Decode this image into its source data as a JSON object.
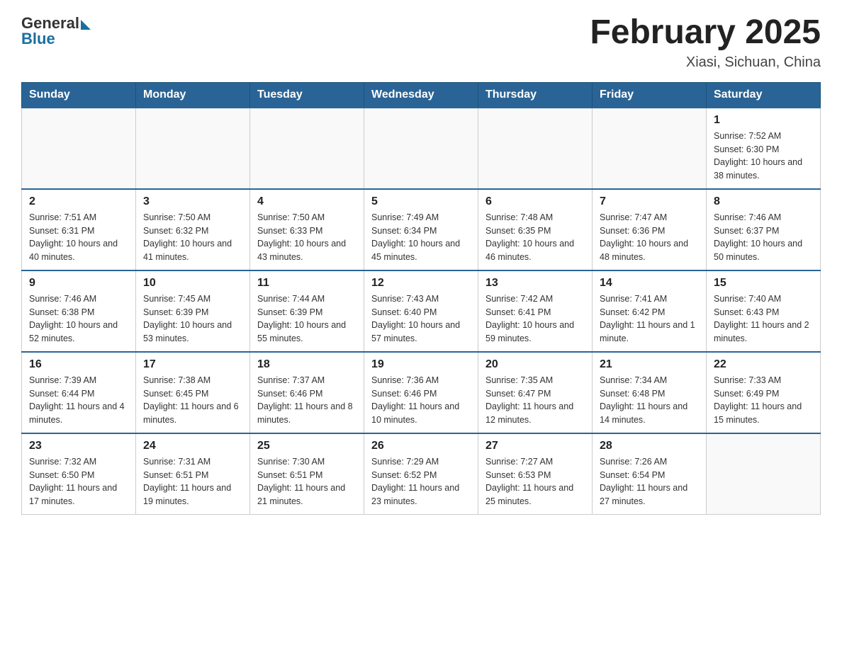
{
  "logo": {
    "general": "General",
    "blue": "Blue"
  },
  "title": {
    "month": "February 2025",
    "location": "Xiasi, Sichuan, China"
  },
  "weekdays": [
    "Sunday",
    "Monday",
    "Tuesday",
    "Wednesday",
    "Thursday",
    "Friday",
    "Saturday"
  ],
  "weeks": [
    [
      {
        "day": "",
        "info": ""
      },
      {
        "day": "",
        "info": ""
      },
      {
        "day": "",
        "info": ""
      },
      {
        "day": "",
        "info": ""
      },
      {
        "day": "",
        "info": ""
      },
      {
        "day": "",
        "info": ""
      },
      {
        "day": "1",
        "info": "Sunrise: 7:52 AM\nSunset: 6:30 PM\nDaylight: 10 hours and 38 minutes."
      }
    ],
    [
      {
        "day": "2",
        "info": "Sunrise: 7:51 AM\nSunset: 6:31 PM\nDaylight: 10 hours and 40 minutes."
      },
      {
        "day": "3",
        "info": "Sunrise: 7:50 AM\nSunset: 6:32 PM\nDaylight: 10 hours and 41 minutes."
      },
      {
        "day": "4",
        "info": "Sunrise: 7:50 AM\nSunset: 6:33 PM\nDaylight: 10 hours and 43 minutes."
      },
      {
        "day": "5",
        "info": "Sunrise: 7:49 AM\nSunset: 6:34 PM\nDaylight: 10 hours and 45 minutes."
      },
      {
        "day": "6",
        "info": "Sunrise: 7:48 AM\nSunset: 6:35 PM\nDaylight: 10 hours and 46 minutes."
      },
      {
        "day": "7",
        "info": "Sunrise: 7:47 AM\nSunset: 6:36 PM\nDaylight: 10 hours and 48 minutes."
      },
      {
        "day": "8",
        "info": "Sunrise: 7:46 AM\nSunset: 6:37 PM\nDaylight: 10 hours and 50 minutes."
      }
    ],
    [
      {
        "day": "9",
        "info": "Sunrise: 7:46 AM\nSunset: 6:38 PM\nDaylight: 10 hours and 52 minutes."
      },
      {
        "day": "10",
        "info": "Sunrise: 7:45 AM\nSunset: 6:39 PM\nDaylight: 10 hours and 53 minutes."
      },
      {
        "day": "11",
        "info": "Sunrise: 7:44 AM\nSunset: 6:39 PM\nDaylight: 10 hours and 55 minutes."
      },
      {
        "day": "12",
        "info": "Sunrise: 7:43 AM\nSunset: 6:40 PM\nDaylight: 10 hours and 57 minutes."
      },
      {
        "day": "13",
        "info": "Sunrise: 7:42 AM\nSunset: 6:41 PM\nDaylight: 10 hours and 59 minutes."
      },
      {
        "day": "14",
        "info": "Sunrise: 7:41 AM\nSunset: 6:42 PM\nDaylight: 11 hours and 1 minute."
      },
      {
        "day": "15",
        "info": "Sunrise: 7:40 AM\nSunset: 6:43 PM\nDaylight: 11 hours and 2 minutes."
      }
    ],
    [
      {
        "day": "16",
        "info": "Sunrise: 7:39 AM\nSunset: 6:44 PM\nDaylight: 11 hours and 4 minutes."
      },
      {
        "day": "17",
        "info": "Sunrise: 7:38 AM\nSunset: 6:45 PM\nDaylight: 11 hours and 6 minutes."
      },
      {
        "day": "18",
        "info": "Sunrise: 7:37 AM\nSunset: 6:46 PM\nDaylight: 11 hours and 8 minutes."
      },
      {
        "day": "19",
        "info": "Sunrise: 7:36 AM\nSunset: 6:46 PM\nDaylight: 11 hours and 10 minutes."
      },
      {
        "day": "20",
        "info": "Sunrise: 7:35 AM\nSunset: 6:47 PM\nDaylight: 11 hours and 12 minutes."
      },
      {
        "day": "21",
        "info": "Sunrise: 7:34 AM\nSunset: 6:48 PM\nDaylight: 11 hours and 14 minutes."
      },
      {
        "day": "22",
        "info": "Sunrise: 7:33 AM\nSunset: 6:49 PM\nDaylight: 11 hours and 15 minutes."
      }
    ],
    [
      {
        "day": "23",
        "info": "Sunrise: 7:32 AM\nSunset: 6:50 PM\nDaylight: 11 hours and 17 minutes."
      },
      {
        "day": "24",
        "info": "Sunrise: 7:31 AM\nSunset: 6:51 PM\nDaylight: 11 hours and 19 minutes."
      },
      {
        "day": "25",
        "info": "Sunrise: 7:30 AM\nSunset: 6:51 PM\nDaylight: 11 hours and 21 minutes."
      },
      {
        "day": "26",
        "info": "Sunrise: 7:29 AM\nSunset: 6:52 PM\nDaylight: 11 hours and 23 minutes."
      },
      {
        "day": "27",
        "info": "Sunrise: 7:27 AM\nSunset: 6:53 PM\nDaylight: 11 hours and 25 minutes."
      },
      {
        "day": "28",
        "info": "Sunrise: 7:26 AM\nSunset: 6:54 PM\nDaylight: 11 hours and 27 minutes."
      },
      {
        "day": "",
        "info": ""
      }
    ]
  ]
}
